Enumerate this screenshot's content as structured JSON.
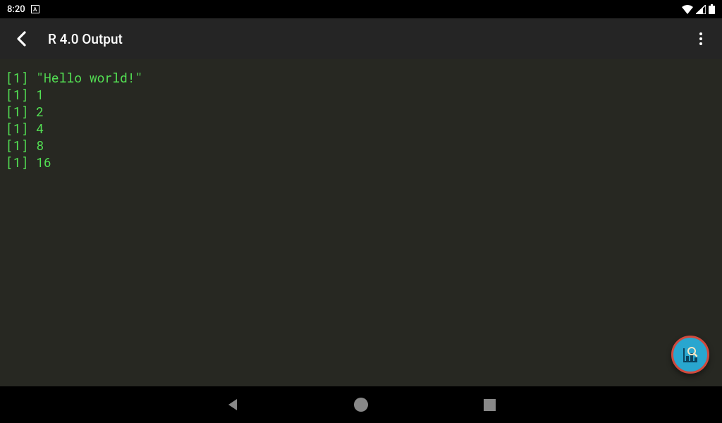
{
  "status_bar": {
    "time": "8:20",
    "notif_letter": "A"
  },
  "app_bar": {
    "title": "R 4.0 Output"
  },
  "output": {
    "lines": [
      "[1] \"Hello world!\"",
      "[1] 1",
      "[1] 2",
      "[1] 4",
      "[1] 8",
      "[1] 16"
    ]
  },
  "colors": {
    "terminal_bg": "#272822",
    "terminal_fg": "#53e053",
    "app_bar_bg": "#252525",
    "fab_bg": "#29a6cf",
    "fab_border": "#d14a3e"
  }
}
